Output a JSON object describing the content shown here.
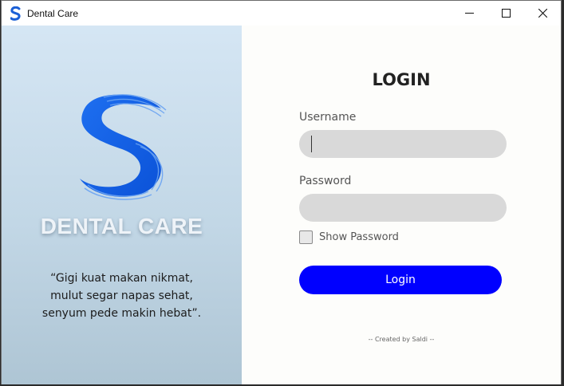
{
  "window": {
    "title": "Dental Care",
    "controls": [
      "minimize-icon",
      "maximize-icon",
      "close-icon"
    ]
  },
  "left_panel": {
    "brand": "DENTAL CARE",
    "quote": [
      "“Gigi kuat makan nikmat,",
      "mulut segar napas sehat,",
      "senyum pede makin hebat”."
    ]
  },
  "login": {
    "title": "LOGIN",
    "username_label": "Username",
    "username_value": "",
    "password_label": "Password",
    "password_value": "",
    "show_password_label": "Show Password",
    "show_password_checked": false,
    "button_label": "Login",
    "credit": "-- Created by Saldi --"
  },
  "colors": {
    "accent": "#0000ff",
    "logo_blue": "#1565e8",
    "field_bg": "#d9d9d9"
  }
}
